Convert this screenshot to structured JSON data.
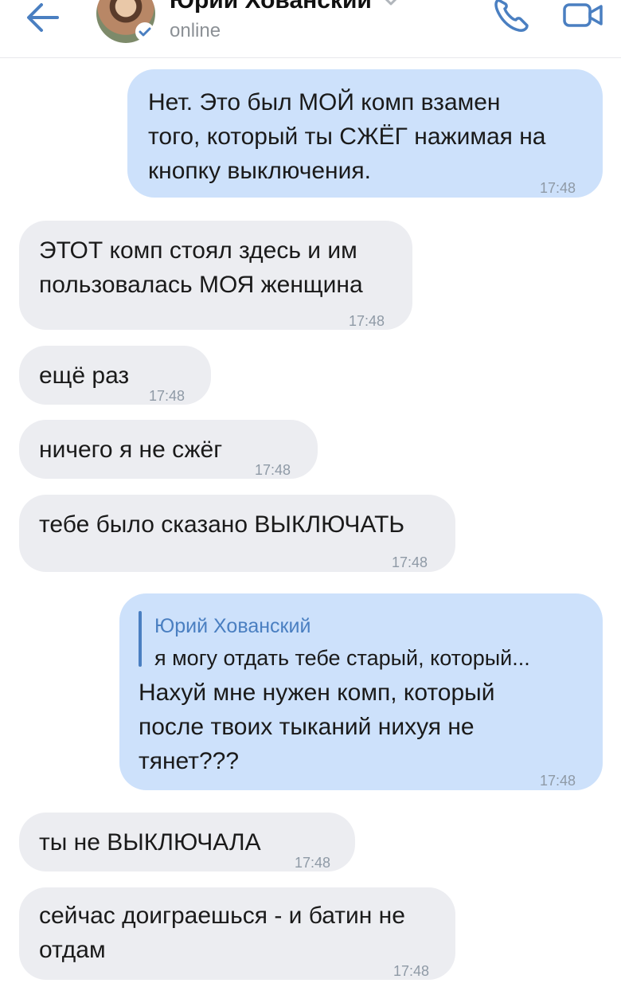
{
  "header": {
    "contact_name": "Юрий Хованский",
    "status": "online",
    "icons": {
      "back": "back-arrow-icon",
      "verified": "verified-check-icon",
      "call": "phone-icon",
      "video": "video-camera-icon",
      "chevron": "chevron-down-icon"
    }
  },
  "colors": {
    "outgoing_bubble": "#cde1fb",
    "incoming_bubble": "#ecedf1",
    "accent": "#4a7fc1",
    "timestamp": "#8f9aa6"
  },
  "messages": [
    {
      "direction": "outgoing",
      "lines": [
        "Нет. Это был МОЙ комп взамен",
        "того, который ты СЖЁГ нажимая на",
        "кнопку выключения."
      ],
      "time": "17:48"
    },
    {
      "direction": "incoming",
      "lines": [
        "ЭТОТ комп стоял здесь и им",
        "пользовалась МОЯ женщина"
      ],
      "time": "17:48"
    },
    {
      "direction": "incoming",
      "lines": [
        "ещё раз"
      ],
      "time": "17:48"
    },
    {
      "direction": "incoming",
      "lines": [
        "ничего я не сжёг"
      ],
      "time": "17:48"
    },
    {
      "direction": "incoming",
      "lines": [
        "тебе было сказано ВЫКЛЮЧАТЬ"
      ],
      "time": "17:48"
    },
    {
      "direction": "outgoing",
      "reply_to": {
        "author": "Юрий Хованский",
        "text": "я могу отдать тебе старый, который..."
      },
      "lines": [
        "Нахуй мне нужен комп, который",
        "после твоих тыканий нихуя не",
        "тянет???"
      ],
      "time": "17:48"
    },
    {
      "direction": "incoming",
      "lines": [
        "ты не ВЫКЛЮЧАЛА"
      ],
      "time": "17:48"
    },
    {
      "direction": "incoming",
      "lines": [
        "сейчас доиграешься - и батин не",
        "отдам"
      ],
      "time": "17:48"
    }
  ]
}
